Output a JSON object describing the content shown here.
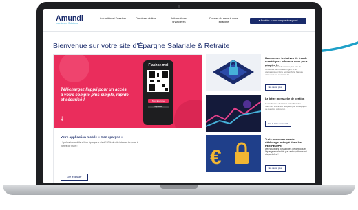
{
  "nav": {
    "logo_main": "Amundi",
    "logo_sub": "Investment Solutions",
    "items": [
      {
        "label": "Actualités et Dossiers"
      },
      {
        "label": "Dernières vidéos"
      },
      {
        "label": "Informations financières"
      },
      {
        "label": "Donner du sens à votre épargne"
      }
    ],
    "cta_label": "Accéder à mon compte épargnant"
  },
  "page_title": "Bienvenue sur votre site d'Épargne Salariale & Retraite",
  "promo": {
    "text": "Téléchargez l'appli pour un accès à votre compte plus simple, rapide et sécurisé !",
    "phone_label": "Flashez-moi",
    "phone_button": "Mon Épargne",
    "phone_store": "App Store"
  },
  "left_card": {
    "title": "Votre application mobile « Mon épargne »",
    "text": "L'application mobile « Mon épargne » c'est 100% du site internet toujours à portée de main !",
    "button": "Lire le dossier"
  },
  "news": [
    {
      "title": "Hausse des tentatives de fraude numérique : informez-vous pour adopter l...",
      "text": "Depuis le début de l'année, les cas de tentatives de fraude en ligne et les opérations en ligne sont en forte hausse dans tous les secteurs da...",
      "button": "En savoir plus"
    },
    {
      "title": "La lettre mensuelle de gestion",
      "text": "Consultez les dernières actualités des marchés financiers rédigées par les équipes de Gestion d'Amundi.",
      "button": "Voir la lettre mensuelle"
    },
    {
      "title": "Trois nouveaux cas de déblocage anticipé dans les PEE/PEG/PEI",
      "text": "De nouvelles possibilités de débloquer l'épargne salariale par anticipation sont disponibles !",
      "button": "En savoir plus"
    }
  ],
  "colors": {
    "brand_navy": "#1a2b6b",
    "accent_cyan": "#1ea0c8",
    "promo_pink": "#ea2d5c"
  }
}
